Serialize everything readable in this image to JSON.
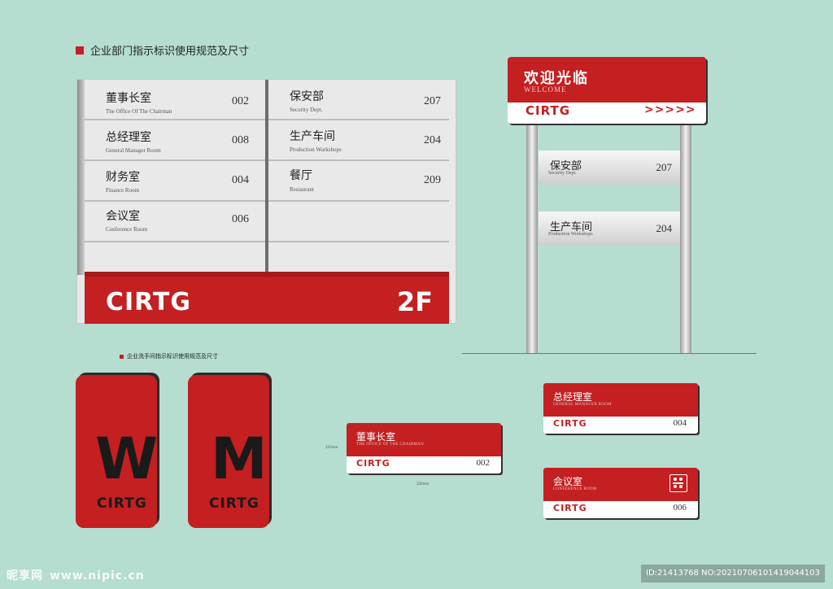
{
  "title_main": "企业部门指示标识使用规范及尺寸",
  "title_restroom": "企业洗手间指示标识使用规范及尺寸",
  "brand": "CIRTG",
  "directory": {
    "floor": "2F",
    "left": [
      {
        "cn": "董事长室",
        "en": "The Office Of The Chairman",
        "num": "002"
      },
      {
        "cn": "总经理室",
        "en": "General Manager Room",
        "num": "008"
      },
      {
        "cn": "财务室",
        "en": "Finance Room",
        "num": "004"
      },
      {
        "cn": "会议室",
        "en": "Conference Room",
        "num": "006"
      }
    ],
    "right": [
      {
        "cn": "保安部",
        "en": "Security Dept.",
        "num": "207"
      },
      {
        "cn": "生产车间",
        "en": "Production Workshops",
        "num": "204"
      },
      {
        "cn": "餐厅",
        "en": "Restaurant",
        "num": "209"
      }
    ]
  },
  "welcome": {
    "cn": "欢迎光临",
    "en": "WELCOME",
    "arrows": ">>>>>",
    "signs": [
      {
        "cn": "保安部",
        "en": "Security Dept.",
        "num": "207"
      },
      {
        "cn": "生产车间",
        "en": "Production Workshops",
        "num": "204"
      }
    ]
  },
  "restroom": {
    "women": "W",
    "men": "M"
  },
  "plates": {
    "chairman": {
      "cn": "董事长室",
      "en": "THE OFFICE OF THE CHAIRMAN",
      "num": "002",
      "dim_h": "120mm",
      "dim_w": "320mm"
    },
    "gm": {
      "cn": "总经理室",
      "en": "GENERAL MANAGER ROOM",
      "num": "004"
    },
    "conf": {
      "cn": "会议室",
      "en": "CONFERENCE ROOM",
      "num": "006"
    }
  },
  "watermark": {
    "site": "昵享网",
    "url": "www.nipic.cn",
    "id": "ID:21413768 NO:20210706101419044103"
  }
}
